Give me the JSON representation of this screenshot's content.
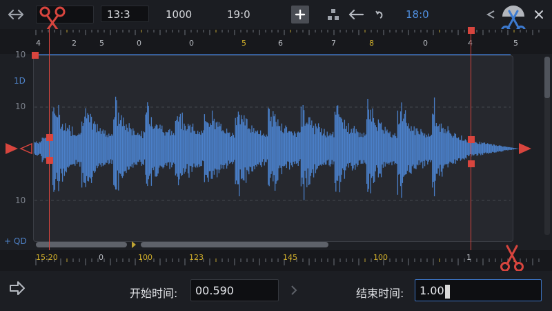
{
  "toolbar": {
    "box1_value": "",
    "box2_value": "13:3",
    "text_1000": "1000",
    "text_time": "19:0",
    "right_time": "18:0",
    "icons": [
      "expand-horizontal-icon",
      "scissors-icon",
      "add-icon",
      "hierarchy-icon",
      "arrow-left-icon",
      "undo-icon",
      "collapse-icon",
      "scissors-icon",
      "close-icon"
    ]
  },
  "ruler_top": {
    "labels": [
      "4",
      "2",
      "5",
      "0",
      "0",
      "5",
      "6",
      "7",
      "8",
      "0",
      "4",
      "5"
    ],
    "gold_labels": [
      "5",
      "8"
    ]
  },
  "waveform": {
    "y_labels": [
      "10",
      "1D",
      "10",
      "10",
      "+ QD"
    ],
    "color": "#4a7fc8",
    "marker_color": "#d8453e"
  },
  "ruler_bottom": {
    "labels": [
      "15:20",
      "0",
      "100",
      "123",
      "145",
      "100",
      "1"
    ]
  },
  "bottom_bar": {
    "start_label": "开始时间:",
    "start_value": "00.590",
    "end_label": "结束时间:",
    "end_value": "1.00"
  }
}
